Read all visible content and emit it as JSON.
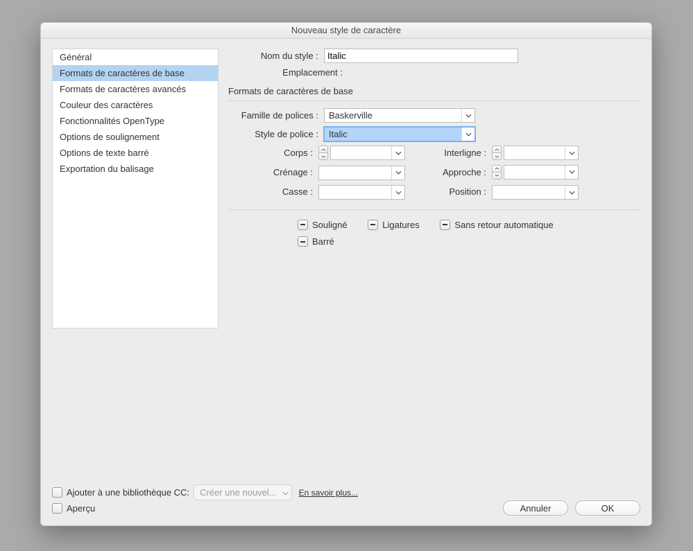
{
  "window": {
    "title": "Nouveau style de caractère"
  },
  "sidebar": {
    "items": [
      {
        "label": "Général"
      },
      {
        "label": "Formats de caractères de base"
      },
      {
        "label": "Formats de caractères avancés"
      },
      {
        "label": "Couleur des caractères"
      },
      {
        "label": "Fonctionnalités OpenType"
      },
      {
        "label": "Options de soulignement"
      },
      {
        "label": "Options de texte barré"
      },
      {
        "label": "Exportation du balisage"
      }
    ],
    "selected_index": 1
  },
  "header": {
    "name_label": "Nom du style :",
    "name_value": "Italic",
    "location_label": "Emplacement :"
  },
  "panel": {
    "title": "Formats de caractères de base",
    "family_label": "Famille de polices :",
    "family_value": "Baskerville",
    "style_label": "Style de police :",
    "style_value": "Italic",
    "size_label": "Corps :",
    "leading_label": "Interligne :",
    "kerning_label": "Crénage :",
    "tracking_label": "Approche :",
    "case_label": "Casse :",
    "position_label": "Position :",
    "checks": {
      "underline": "Souligné",
      "ligatures": "Ligatures",
      "nobreak": "Sans retour automatique",
      "strike": "Barré"
    }
  },
  "footer": {
    "add_cc_label": "Ajouter à une bibliothèque CC:",
    "cc_combo": "Créer une nouvel...",
    "learn_more": "En savoir plus...",
    "preview_label": "Aperçu",
    "cancel": "Annuler",
    "ok": "OK"
  }
}
